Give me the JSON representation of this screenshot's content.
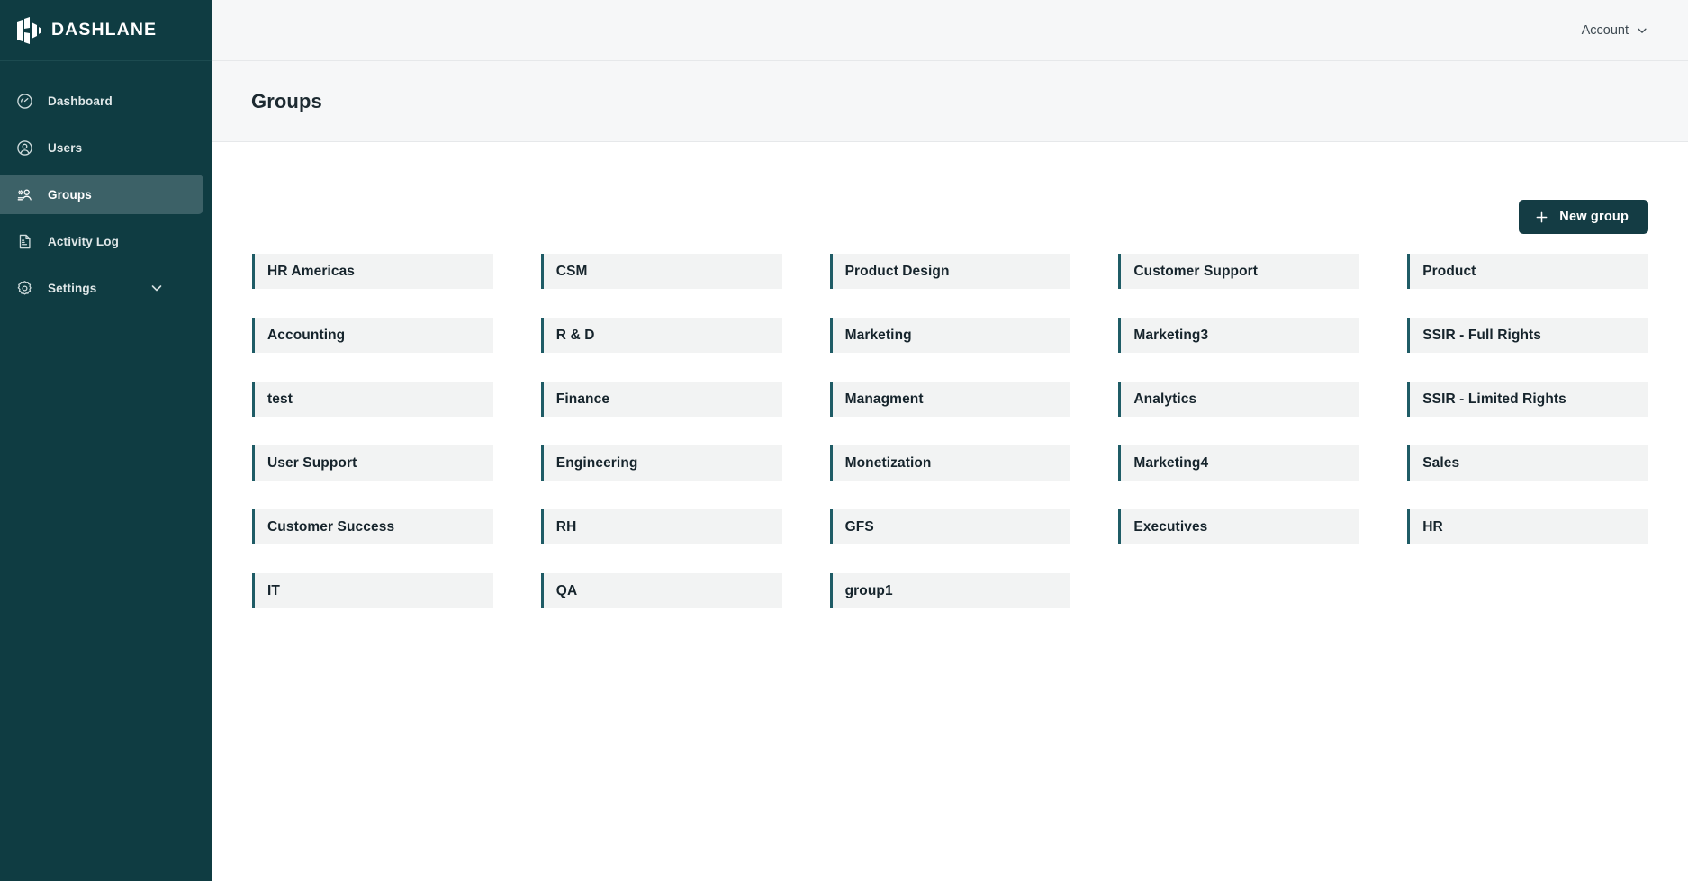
{
  "brand": {
    "name": "DASHLANE",
    "logo_icon": "dashlane-logo-icon"
  },
  "colors": {
    "sidebar_bg": "#0f3c42",
    "sidebar_active_bg": "#3c6167",
    "accent_bar": "#1f5c66",
    "card_bg": "#f2f3f3",
    "button_bg": "#143c44",
    "header_bg": "#f6f7f8",
    "text_dark": "#16242c"
  },
  "sidebar": {
    "items": [
      {
        "label": "Dashboard",
        "icon": "gauge-icon",
        "active": false,
        "has_chevron": false
      },
      {
        "label": "Users",
        "icon": "user-circle-icon",
        "active": false,
        "has_chevron": false
      },
      {
        "label": "Groups",
        "icon": "people-group-icon",
        "active": true,
        "has_chevron": false
      },
      {
        "label": "Activity Log",
        "icon": "document-icon",
        "active": false,
        "has_chevron": false
      },
      {
        "label": "Settings",
        "icon": "gear-icon",
        "active": false,
        "has_chevron": true
      }
    ]
  },
  "topbar": {
    "account_label": "Account",
    "account_chevron_icon": "chevron-down-icon"
  },
  "header": {
    "title": "Groups"
  },
  "toolbar": {
    "new_group_label": "New group",
    "plus_icon": "plus-icon"
  },
  "groups": [
    "HR Americas",
    "CSM",
    "Product Design",
    "Customer Support",
    "Product",
    "Accounting",
    "R & D",
    "Marketing",
    "Marketing3",
    "SSIR - Full Rights",
    "test",
    "Finance",
    "Managment",
    "Analytics",
    "SSIR - Limited Rights",
    "User Support",
    "Engineering",
    "Monetization",
    "Marketing4",
    "Sales",
    "Customer Success",
    "RH",
    "GFS",
    "Executives",
    "HR",
    "IT",
    "QA",
    "group1"
  ]
}
